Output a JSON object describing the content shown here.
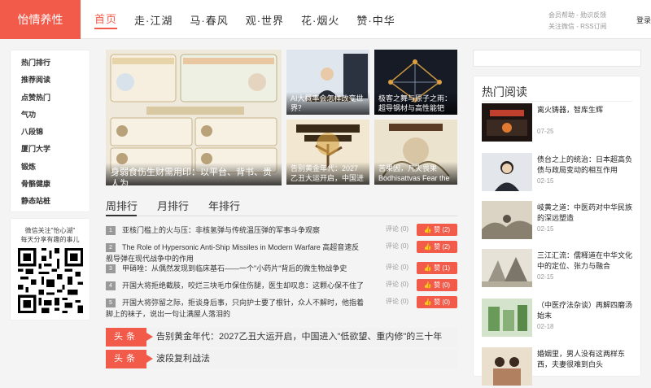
{
  "site": {
    "logo": "怡情养性"
  },
  "nav": [
    "首页",
    "走·江湖",
    "马·春风",
    "观·世界",
    "花·烟火",
    "赞·中华"
  ],
  "toplinks": {
    "line1": "会员帮助 - 勋识反馈",
    "line2": "关注微信 - RSS订阅",
    "login": "登录"
  },
  "sidebar": [
    "热门排行",
    "推荐阅读",
    "点赞热门",
    "气功",
    "八段锦",
    "厦门大学",
    "锻炼",
    "骨骼健康",
    "静态站桩"
  ],
  "wechat": {
    "line1": "微信关注\"怡心湖\"",
    "line2": "每天分享有趣的事儿"
  },
  "featured": {
    "big": "身弱食伤生财需用印：以平台、背书、贵人为",
    "t1": "AI大概率会怎样改变世界？",
    "t2": "极客之舞与原子之雨：超导钢材与高性能钯",
    "t3": "告别黄金年代：2027乙丑大运开启，中国进",
    "t4": "苦果因，凡夫畏果Bodhisattvas Fear the"
  },
  "tabs": [
    "周排行",
    "月排行",
    "年排行"
  ],
  "ranking": [
    {
      "num": "1",
      "title": "亚核门槛上的火与压：非核氢弹与传统温压弹的军事斗争观察",
      "comments": "评论 (0)",
      "likes": "赞 (2)"
    },
    {
      "num": "2",
      "title": "The Role of Hypersonic Anti-Ship Missiles in Modern Warfare 高超音速反舰导弹在现代战争中的作用",
      "comments": "评论 (0)",
      "likes": "赞 (2)"
    },
    {
      "num": "3",
      "title": "甲硝唑：从偶然发现到临床基石——一个\"小药片\"背后的微生物战争史",
      "comments": "评论 (0)",
      "likes": "赞 (1)"
    },
    {
      "num": "4",
      "title": "开国大将拒绝截肢，咬烂三块毛巾保住伤腿，医生却叹息：这颗心保不住了",
      "comments": "评论 (0)",
      "likes": "赞 (0)"
    },
    {
      "num": "5",
      "title": "开国大将弥留之际，拒谈身后事，只向护士要了根针，众人不解时，他指着脚上的袜子，说出一句让满屋人落泪的",
      "comments": "评论 (0)",
      "likes": "赞 (0)"
    }
  ],
  "headlines": [
    {
      "tag": "头条",
      "title": "告别黄金年代：2027乙丑大运开启，中国进入\"低欲望、重内修\"的三十年"
    },
    {
      "tag": "头条",
      "title": "波段复利战法"
    }
  ],
  "hot": {
    "title": "热门阅读",
    "items": [
      {
        "title": "离火铸器，智库生辉",
        "date": "07-25"
      },
      {
        "title": "债台之上的统治：日本超高负债与政局变动的相互作用",
        "date": "02-15"
      },
      {
        "title": "岐黄之道：中医药对中华民族的深远塑造",
        "date": "02-15"
      },
      {
        "title": "三江汇流：儒释道在中华文化中的定位、张力与融合",
        "date": "02-15"
      },
      {
        "title": "（中医疗法杂谈）再解四磨汤始末",
        "date": "02-18"
      },
      {
        "title": "婚姻里，男人没有这两样东西，夫妻很难到白头",
        "date": ""
      }
    ]
  }
}
